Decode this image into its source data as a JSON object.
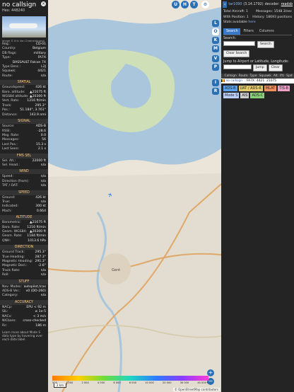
{
  "aircraft": {
    "callsign": "no callsign",
    "hex_label": "Hex:",
    "hex": "448240",
    "photo_credit": "Image © Eric Van Craenenbroeck"
  },
  "info_rows": [
    {
      "label": "Reg.:",
      "value": "CD-01"
    },
    {
      "label": "Country:",
      "value": "Belgium"
    },
    {
      "label": "DB flags:",
      "value": "military"
    },
    {
      "label": "Type:",
      "value": "FA7X"
    },
    {
      "label": "",
      "value": "DASSAULT Falcon 7X"
    },
    {
      "label": "Type Desc.:",
      "value": "L2J"
    },
    {
      "label": "Squawk:",
      "value": "4421"
    },
    {
      "label": "Route:",
      "value": "n/a"
    }
  ],
  "sections": [
    {
      "title": "SPATIAL",
      "rows": [
        {
          "label": "Groundspeed:",
          "value": "426 kt"
        },
        {
          "label": "Baro. altitude:",
          "value": "▲21075 ft"
        },
        {
          "label": "WGS84 altitude:",
          "value": "▲20300 ft"
        },
        {
          "label": "Vert. Rate:",
          "value": "1216 ft/min"
        },
        {
          "label": "Track:",
          "value": "295.3°"
        },
        {
          "label": "Pos.:",
          "value": "51.184°, 3.761°"
        },
        {
          "label": "Distance:",
          "value": "143.9 nmi"
        }
      ]
    },
    {
      "title": "SIGNAL",
      "rows": [
        {
          "label": "Source:",
          "value": "ADS-B"
        },
        {
          "label": "RSSI:",
          "value": "-28.6"
        },
        {
          "label": "Msg. Rate:",
          "value": "0.0"
        },
        {
          "label": "Messages:",
          "value": "56"
        },
        {
          "label": "Last Pos.:",
          "value": "15.3 s"
        },
        {
          "label": "Last Seen:",
          "value": "2.1 s"
        }
      ]
    },
    {
      "title": "FMS SEL",
      "rows": [
        {
          "label": "Sel. Alt.:",
          "value": "22000 ft"
        },
        {
          "label": "Sel. Head.:",
          "value": "n/a"
        }
      ]
    },
    {
      "title": "WIND",
      "rows": [
        {
          "label": "Speed:",
          "value": "n/a"
        },
        {
          "label": "Direction (from):",
          "value": "n/a"
        },
        {
          "label": "TAT / OAT:",
          "value": "n/a"
        }
      ]
    },
    {
      "title": "SPEED",
      "rows": [
        {
          "label": "Ground:",
          "value": "426 kt"
        },
        {
          "label": "True:",
          "value": "n/a"
        },
        {
          "label": "Indicated:",
          "value": "300 kt"
        },
        {
          "label": "Mach:",
          "value": "0.664"
        }
      ]
    },
    {
      "title": "ALTITUDE",
      "rows": [
        {
          "label": "Barometric:",
          "value": "▲21075 ft"
        },
        {
          "label": "Baro. Rate:",
          "value": "1216 ft/min"
        },
        {
          "label": "Geom. WGS84:",
          "value": "▲20300 ft"
        },
        {
          "label": "Geom. Rate:",
          "value": "1184 ft/min"
        },
        {
          "label": "QNH:",
          "value": "1013.6 hPa"
        }
      ]
    },
    {
      "title": "DIRECTION",
      "rows": [
        {
          "label": "Ground Track:",
          "value": "295.3°"
        },
        {
          "label": "True Heading:",
          "value": "287.3°"
        },
        {
          "label": "Magnetic Heading:",
          "value": "291.3°"
        },
        {
          "label": "Magnetic Decl.:",
          "value": "-2.6°"
        },
        {
          "label": "Track Rate:",
          "value": "n/a"
        },
        {
          "label": "Roll:",
          "value": "n/a"
        }
      ]
    },
    {
      "title": "STUFF",
      "rows": [
        {
          "label": "Nav. Modes:",
          "value": "autopilot,tcas"
        },
        {
          "label": "ADS-B Ver.:",
          "value": "v0 (DO-260)"
        },
        {
          "label": "Category:",
          "value": "n/a"
        }
      ]
    },
    {
      "title": "ACCURACY",
      "rows": [
        {
          "label": "NACp:",
          "value": "EPU < 92 m"
        },
        {
          "label": "SIL:",
          "value": "≤ 1e-5"
        },
        {
          "label": "NACv:",
          "value": "< 3 m/s"
        },
        {
          "label": "NICbaro:",
          "value": "cross-checked"
        },
        {
          "label": "Rc:",
          "value": "186 m"
        }
      ]
    }
  ],
  "footer_text": "Learn more about Mode S data type by hovering over each data label.",
  "map": {
    "top_buttons": [
      "U",
      "H",
      "T"
    ],
    "vertical_buttons": [
      "L",
      "O",
      "K",
      "M",
      "V",
      "P",
      "I",
      "R"
    ],
    "place_label": "Gent",
    "scale_label": "2 km",
    "attribution": "© OpenStreetMap contributors",
    "zoom_in": "+",
    "zoom_out": "−",
    "altitude_legend": [
      "500",
      "1 000",
      "2 000",
      "4 000",
      "6 000",
      "8 000",
      "10 000",
      "20 000",
      "30 000",
      "40 000+"
    ]
  },
  "right": {
    "version_link": "tar1090",
    "version": "(3.14.1792)",
    "decoder_label": "decoder:",
    "decoder": "readsb",
    "stats": {
      "total_label": "Total Aircraft:",
      "total": "1",
      "messages_label": "Messages:",
      "messages": "1548.3/sec",
      "with_pos_label": "With Position:",
      "with_pos": "1",
      "history_label": "History:",
      "history": "18693 positions",
      "stats_available": "Stats available",
      "stats_link": "here"
    },
    "tabs": [
      "Search",
      "Filters",
      "Columns"
    ],
    "search_label": "Search:",
    "search_button": "Search",
    "clear_search": "Clear Search",
    "jump_label": "Jump to Airport or Latitude, Longitude:",
    "jump_button": "Jump",
    "clear_button": "Clear",
    "table_headers": [
      "",
      "Callsign",
      "Route",
      "Type",
      "Squawk",
      "Alt. (ft)",
      "Spd"
    ],
    "table_row": {
      "callsign": "no callsign",
      "route": "",
      "type": "FA7X",
      "squawk": "4421",
      "alt": "21075",
      "spd": ""
    },
    "filters": [
      {
        "label": "ADS-B",
        "color": "#5aa0f0"
      },
      {
        "label": "UAT / ADS-R",
        "color": "#e6cc6a"
      },
      {
        "label": "MLAT",
        "color": "#f09060"
      },
      {
        "label": "TIS-B",
        "color": "#f0a0c8"
      },
      {
        "label": "Mode S",
        "color": "#bcd0ff"
      },
      {
        "label": "AIS",
        "color": "#cccccc"
      },
      {
        "label": "ADS-C",
        "color": "#8ad07a"
      }
    ]
  }
}
